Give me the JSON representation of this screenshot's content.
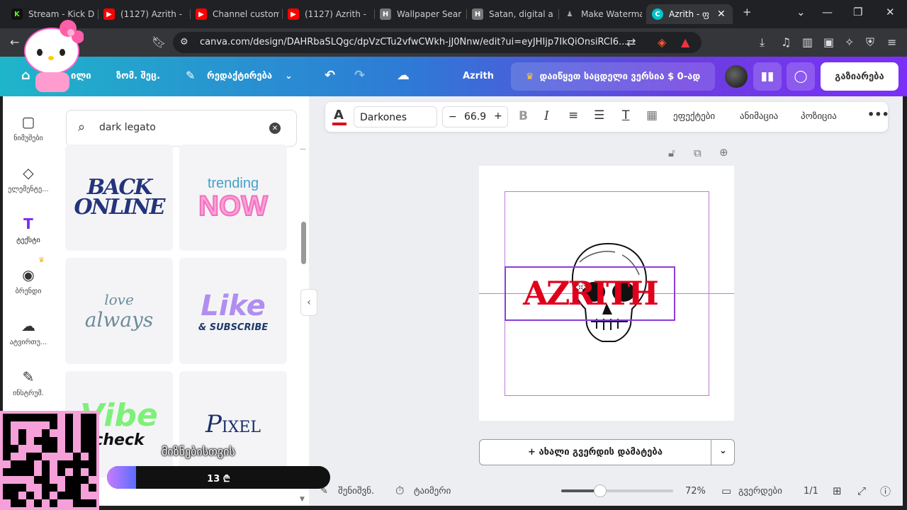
{
  "tabs": [
    {
      "title": "Stream - Kick D",
      "favicon": "K",
      "color": "#53fc18"
    },
    {
      "title": "(1127) Azrith -",
      "favicon": "▶",
      "color": "#ff0000"
    },
    {
      "title": "Channel custom",
      "favicon": "▶",
      "color": "#ff0000"
    },
    {
      "title": "(1127) Azrith -",
      "favicon": "▶",
      "color": "#ff0000"
    },
    {
      "title": "Wallpaper Sear",
      "favicon": "H",
      "color": "#888"
    },
    {
      "title": "Satan, digital a",
      "favicon": "H",
      "color": "#888"
    },
    {
      "title": "Make Waterma",
      "favicon": "♟",
      "color": "#111"
    },
    {
      "title": "Azrith - ფ",
      "favicon": "C",
      "color": "#00c4cc"
    }
  ],
  "browser": {
    "url": "canva.com/design/DAHRbaSLQgc/dpVzCTu2vfwCWkh-jJ0Nnw/edit?ui=eyJHIjp7IkQiOnsiRCI6..."
  },
  "header": {
    "home_suffix": "ილი",
    "file_menu": "ზომ. შეც.",
    "edit_menu": "რედაქტირება",
    "project_name": "Azrith",
    "upgrade_label": "დაიწყეთ საცდელი ვერსია $ 0-ად",
    "share_label": "გაზიარება"
  },
  "rail": [
    {
      "label": "ნიმუშები",
      "icon": "▢"
    },
    {
      "label": "ელემენტე...",
      "icon": "◇"
    },
    {
      "label": "ტექსტი",
      "icon": "T"
    },
    {
      "label": "ბრენდი",
      "icon": "◉"
    },
    {
      "label": "ატვირთუ...",
      "icon": "☁"
    },
    {
      "label": "ინსტრუმ.",
      "icon": "✎"
    }
  ],
  "search": {
    "query": "dark legato"
  },
  "text_tiles": [
    {
      "line1": "BACK",
      "line2": "ONLINE"
    },
    {
      "line1": "trending",
      "line2": "NOW"
    },
    {
      "line1": "love",
      "line2": "always"
    },
    {
      "line1": "Like",
      "line2": "& SUBSCRIBE"
    },
    {
      "line1": "Vibe",
      "line2": "check"
    },
    {
      "line1": "P",
      "line2": "IXEL"
    }
  ],
  "toolbar": {
    "font": "Darkones",
    "size": "66.9",
    "effects": "ეფექტები",
    "animate": "ანიმაცია",
    "position": "პოზიცია"
  },
  "canvas": {
    "text": "AZRITH",
    "accent": "#e0001b"
  },
  "add_page_label": "+ ახალი გვერდის დამატება",
  "footer": {
    "notes": "შენიშვნ.",
    "timer": "ტაიმერი",
    "zoom": "72%",
    "pages": "გვერდები",
    "page_count": "1/1",
    "zoom_fraction": 0.35
  },
  "overlay": {
    "caption": "მიზნებისთვის",
    "goal_label": "13 ₾",
    "goal_fraction": 0.13
  }
}
